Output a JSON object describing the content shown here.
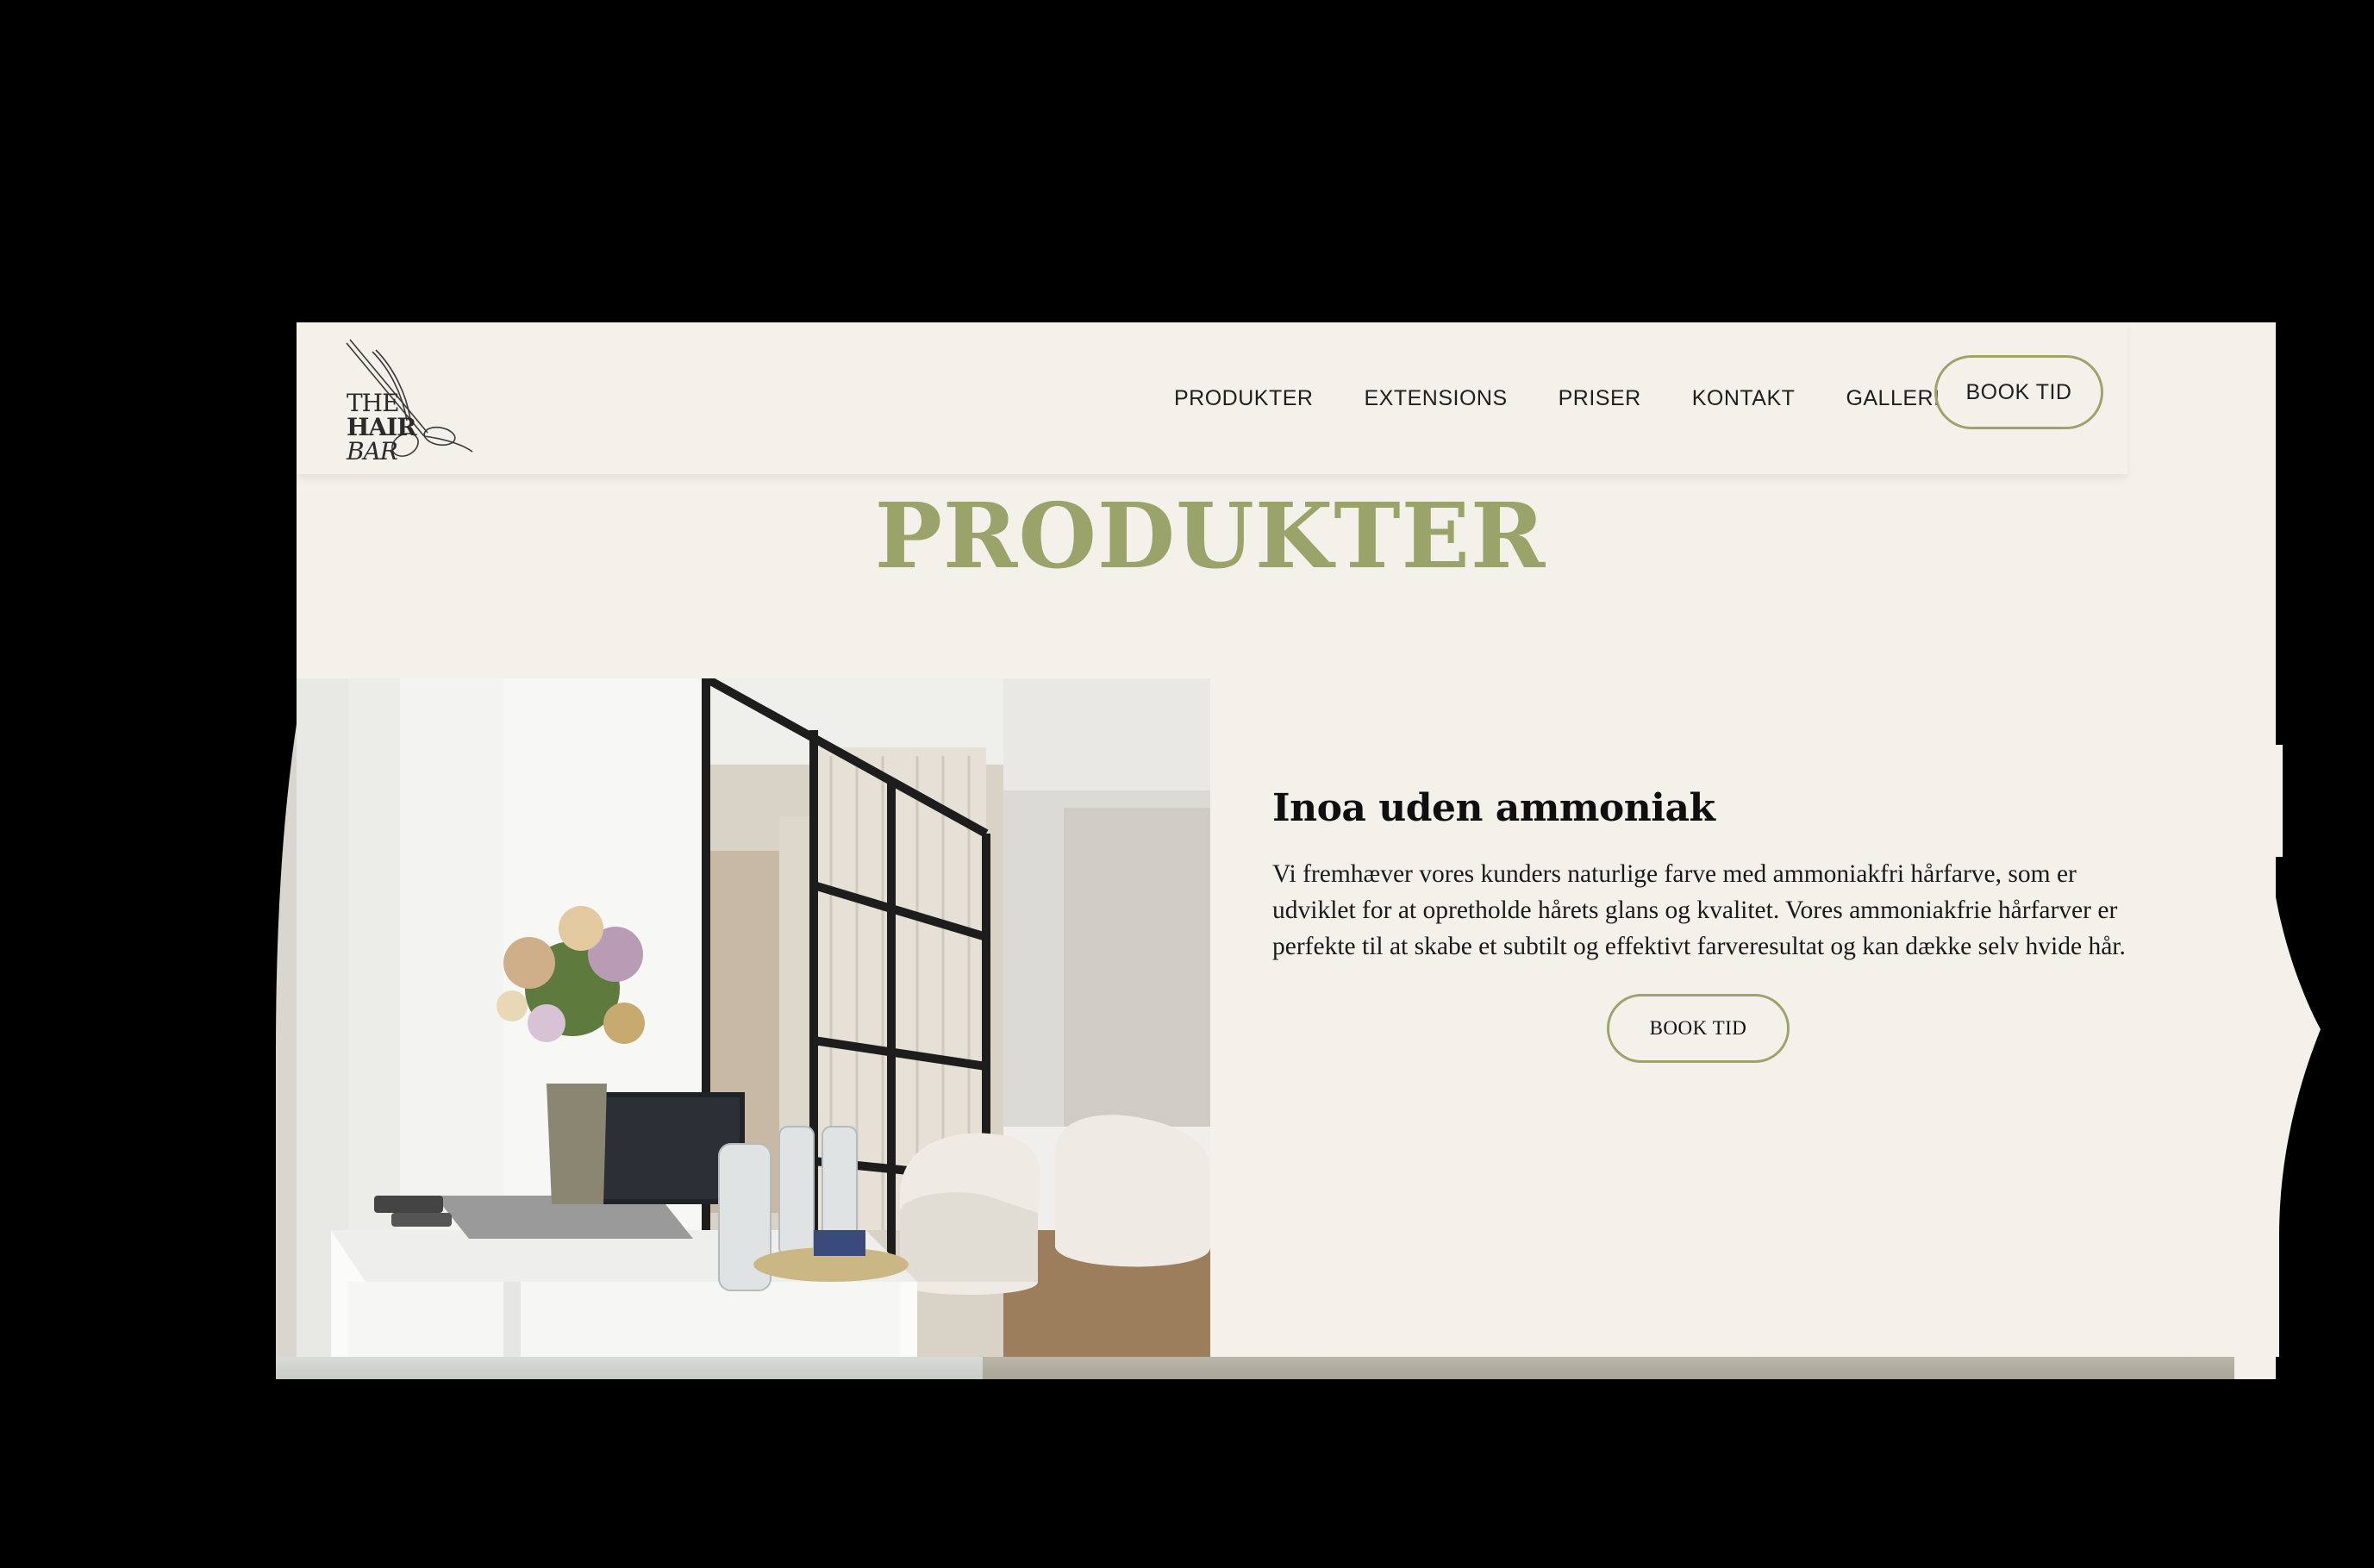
{
  "brand": {
    "logo_line1": "THE",
    "logo_line2": "HAIR",
    "logo_line3": "BAR"
  },
  "nav": {
    "items": [
      {
        "label": "PRODUKTER"
      },
      {
        "label": "EXTENSIONS"
      },
      {
        "label": "PRISER"
      },
      {
        "label": "KONTAKT"
      },
      {
        "label": "GALLERI"
      }
    ],
    "book_label": "BOOK TID"
  },
  "page": {
    "title": "PRODUKTER"
  },
  "section": {
    "heading": "Inoa uden ammoniak",
    "body": "Vi fremhæver vores kunders naturlige farve med ammoniakfri hårfarve, som er udviklet for at opretholde hårets glans og kvalitet. Vores ammoniakfrie hårfarver er perfekte til at skabe et subtilt og effektivt farveresultat og kan dække selv hvide hår.",
    "book_label": "BOOK TID"
  },
  "colors": {
    "background": "#f4f1eb",
    "accent": "#9aa36a",
    "text": "#1f1f1f"
  },
  "icons": {
    "logo": "scissors-icon"
  }
}
